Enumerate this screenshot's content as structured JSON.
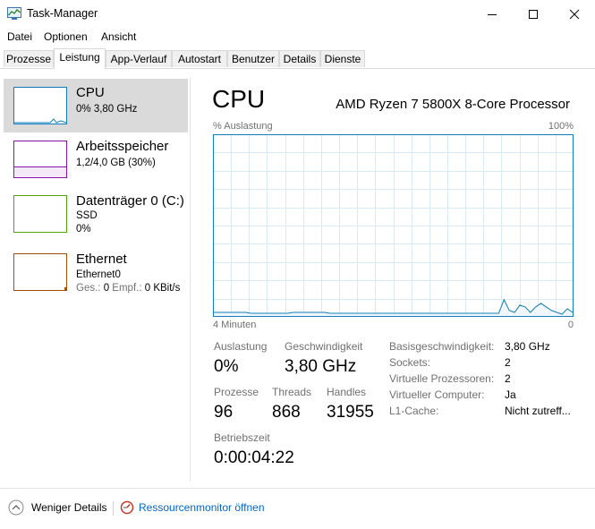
{
  "window": {
    "title": "Task-Manager"
  },
  "menu": [
    "Datei",
    "Optionen",
    "Ansicht"
  ],
  "tabs": [
    "Prozesse",
    "Leistung",
    "App-Verlauf",
    "Autostart",
    "Benutzer",
    "Details",
    "Dienste"
  ],
  "active_tab": "Leistung",
  "resources": [
    {
      "title": "CPU",
      "lines": [
        "0%  3,80 GHz"
      ],
      "color": "#117dbb"
    },
    {
      "title": "Arbeitsspeicher",
      "lines": [
        "1,2/4,0 GB (30%)"
      ],
      "color": "#8b12ae"
    },
    {
      "title": "Datenträger 0 (C:)",
      "lines": [
        "SSD",
        "0%"
      ],
      "color": "#4da60c"
    },
    {
      "title": "Ethernet",
      "lines": [
        "Ethernet0"
      ],
      "color": "#a74f01"
    }
  ],
  "ethernet_rates": {
    "send_label": "Ges.:",
    "send_value": "0",
    "recv_label": "Empf.:",
    "recv_value": "0 KBit/s"
  },
  "main": {
    "title": "CPU",
    "processor": "AMD Ryzen 7 5800X 8-Core Processor",
    "graph_label_top_left": "% Auslastung",
    "graph_label_top_right": "100%",
    "graph_label_bottom_left": "4 Minuten",
    "graph_label_bottom_right": "0"
  },
  "stats": {
    "auslastung_label": "Auslastung",
    "auslastung_value": "0%",
    "geschwindigkeit_label": "Geschwindigkeit",
    "geschwindigkeit_value": "3,80 GHz",
    "prozesse_label": "Prozesse",
    "prozesse_value": "96",
    "threads_label": "Threads",
    "threads_value": "868",
    "handles_label": "Handles",
    "handles_value": "31955",
    "betriebszeit_label": "Betriebszeit",
    "betriebszeit_value": "0:00:04:22"
  },
  "info": [
    {
      "label": "Basisgeschwindigkeit:",
      "value": "3,80 GHz"
    },
    {
      "label": "Sockets:",
      "value": "2"
    },
    {
      "label": "Virtuelle Prozessoren:",
      "value": "2"
    },
    {
      "label": "Virtueller Computer:",
      "value": "Ja"
    },
    {
      "label": "L1-Cache:",
      "value": "Nicht zutreff..."
    }
  ],
  "footer": {
    "fewer_details": "Weniger Details",
    "resource_monitor": "Ressourcenmonitor öffnen"
  },
  "chart_data": {
    "type": "area",
    "ylim": [
      0,
      100
    ],
    "y_unit": "%",
    "x_span_seconds": 240,
    "values": [
      2,
      2,
      2,
      2,
      2,
      2,
      2,
      1.5,
      1.5,
      1.5,
      1.5,
      1.5,
      1.5,
      1.5,
      1.5,
      2,
      2,
      2,
      2,
      2,
      2,
      2,
      1.5,
      1.5,
      1.5,
      1.5,
      1.5,
      1.5,
      1.5,
      1.5,
      1.5,
      1.5,
      1.5,
      1.5,
      1.5,
      1.5,
      1.5,
      1.5,
      1.5,
      1.5,
      1.5,
      1.5,
      1.5,
      1.5,
      1.5,
      1.5,
      1.5,
      1.5,
      1.5,
      1.5,
      1.5,
      1.5,
      1.5,
      1.5,
      1.5,
      9,
      3,
      2,
      6,
      5,
      2,
      5,
      7,
      5,
      3,
      2,
      1,
      4,
      2
    ]
  }
}
